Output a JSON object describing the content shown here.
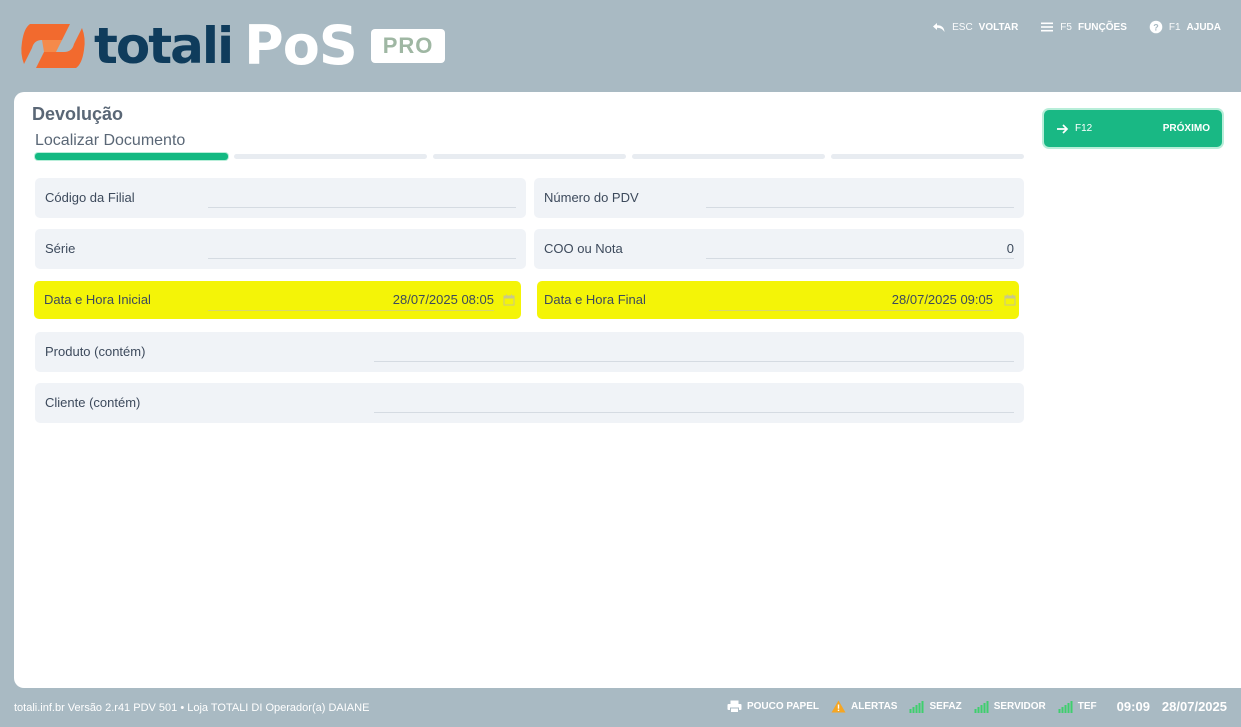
{
  "header": {
    "brand_totali": "totali",
    "brand_pos": "PoS",
    "brand_pro": "PRO",
    "actions": [
      {
        "key": "ESC",
        "label": "VOLTAR",
        "icon": "undo-icon"
      },
      {
        "key": "F5",
        "label": "FUNÇÕES",
        "icon": "menu-icon"
      },
      {
        "key": "F1",
        "label": "AJUDA",
        "icon": "help-icon"
      }
    ]
  },
  "page": {
    "title": "Devolução",
    "step_label": "Localizar Documento"
  },
  "next_button": {
    "key": "F12",
    "label": "PRÓXIMO"
  },
  "fields": {
    "codigo_filial": {
      "label": "Código da Filial",
      "value": ""
    },
    "numero_pdv": {
      "label": "Número do PDV",
      "value": ""
    },
    "serie": {
      "label": "Série",
      "value": ""
    },
    "coo_nota": {
      "label": "COO ou Nota",
      "value": "0"
    },
    "data_inicial": {
      "label": "Data e Hora Inicial",
      "value": "28/07/2025 08:05"
    },
    "data_final": {
      "label": "Data e Hora Final",
      "value": "28/07/2025 09:05"
    },
    "produto": {
      "label": "Produto (contém)",
      "value": ""
    },
    "cliente": {
      "label": "Cliente (contém)",
      "value": ""
    }
  },
  "footer": {
    "info": "totali.inf.br Versão 2.r41 PDV 501  •  Loja TOTALI DI Operador(a) DAIANE",
    "statuses": [
      {
        "label": "POUCO PAPEL",
        "icon": "printer-icon"
      },
      {
        "label": "ALERTAS",
        "icon": "warning-icon"
      },
      {
        "label": "SEFAZ",
        "icon": "signal-icon"
      },
      {
        "label": "SERVIDOR",
        "icon": "signal-icon"
      },
      {
        "label": "TEF",
        "icon": "signal-icon"
      }
    ],
    "time": "09:09",
    "date": "28/07/2025"
  },
  "colors": {
    "accent": "#19b884",
    "header_bg": "#a9bac3",
    "highlight": "#f4f407",
    "brand_dark": "#0f3c5c",
    "brand_orange": "#f26a2e",
    "warning": "#f5a623",
    "signal": "#3ecf6e"
  }
}
